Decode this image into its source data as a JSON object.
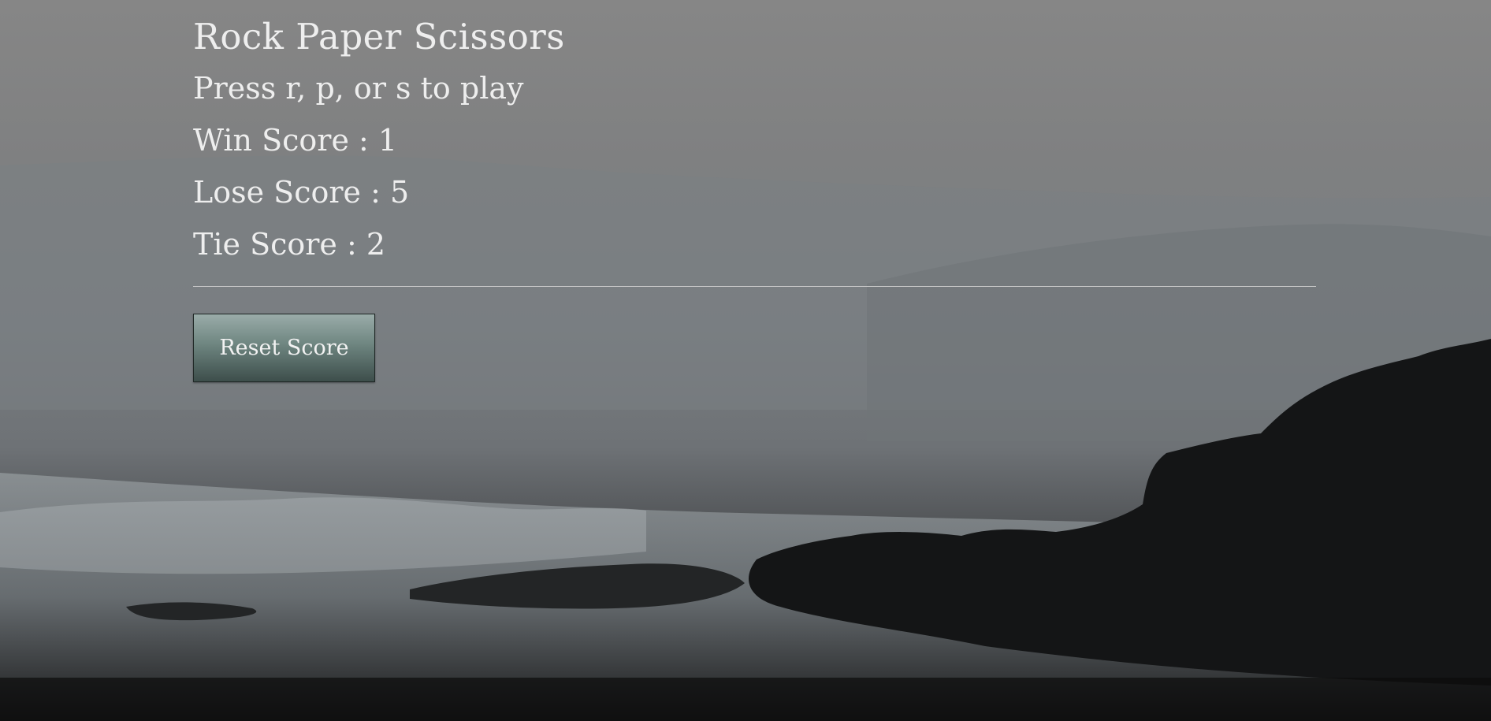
{
  "game": {
    "title": "Rock Paper Scissors",
    "instructions": "Press r, p, or s to play",
    "win_label": "Win Score : 1",
    "lose_label": "Lose Score : 5",
    "tie_label": "Tie Score : 2",
    "reset_label": "Reset Score"
  },
  "scores": {
    "win": 1,
    "lose": 5,
    "tie": 2
  },
  "colors": {
    "text": "#eeeeee",
    "button_top": "#9aaca9",
    "button_bottom": "#3d4e4b"
  }
}
